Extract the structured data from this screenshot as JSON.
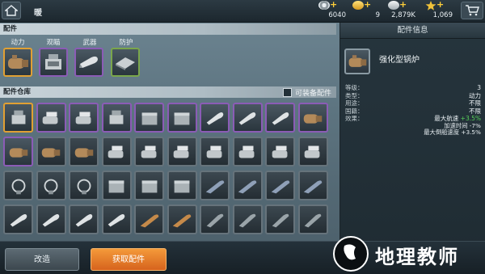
{
  "topbar": {
    "title": "暖",
    "resources": [
      {
        "name": "fuel-icon",
        "value": "6040",
        "color": "#cfd6da"
      },
      {
        "name": "gold-icon",
        "value": "9",
        "color": "#f0c23a"
      },
      {
        "name": "silver-icon",
        "value": "2,879K",
        "color": "#d8dde0"
      },
      {
        "name": "star-icon",
        "value": "1,069",
        "color": "#f0c23a"
      }
    ],
    "plus": "+"
  },
  "equipment": {
    "section_title": "配件",
    "categories": [
      "动力",
      "观瞄",
      "武器",
      "防护"
    ]
  },
  "warehouse": {
    "section_title": "配件仓库",
    "filter_label": "可装备配件"
  },
  "info": {
    "panel_title": "配件信息",
    "name": "强化型锅炉",
    "stats": [
      {
        "label": "等级：",
        "value": "3"
      },
      {
        "label": "类型：",
        "value": "动力"
      },
      {
        "label": "用途：",
        "value": "不限"
      },
      {
        "label": "国籍：",
        "value": "不限"
      }
    ],
    "effect_label": "效果：",
    "effects": [
      {
        "text": "最大航速",
        "delta": "+3.5%"
      },
      {
        "text": "加速时间",
        "delta": "-7%"
      },
      {
        "text": "最大倒船速度",
        "delta": "+3.5%"
      }
    ]
  },
  "buttons": {
    "modify": "改造",
    "get": "获取配件"
  },
  "watermark": {
    "text": "地理教师"
  },
  "colors": {
    "rare_border": "#8b5cb6",
    "selected_border": "#e1a033",
    "green_border": "#7aa64b",
    "positive": "#58d05a",
    "get_button": "#e97a2a"
  }
}
